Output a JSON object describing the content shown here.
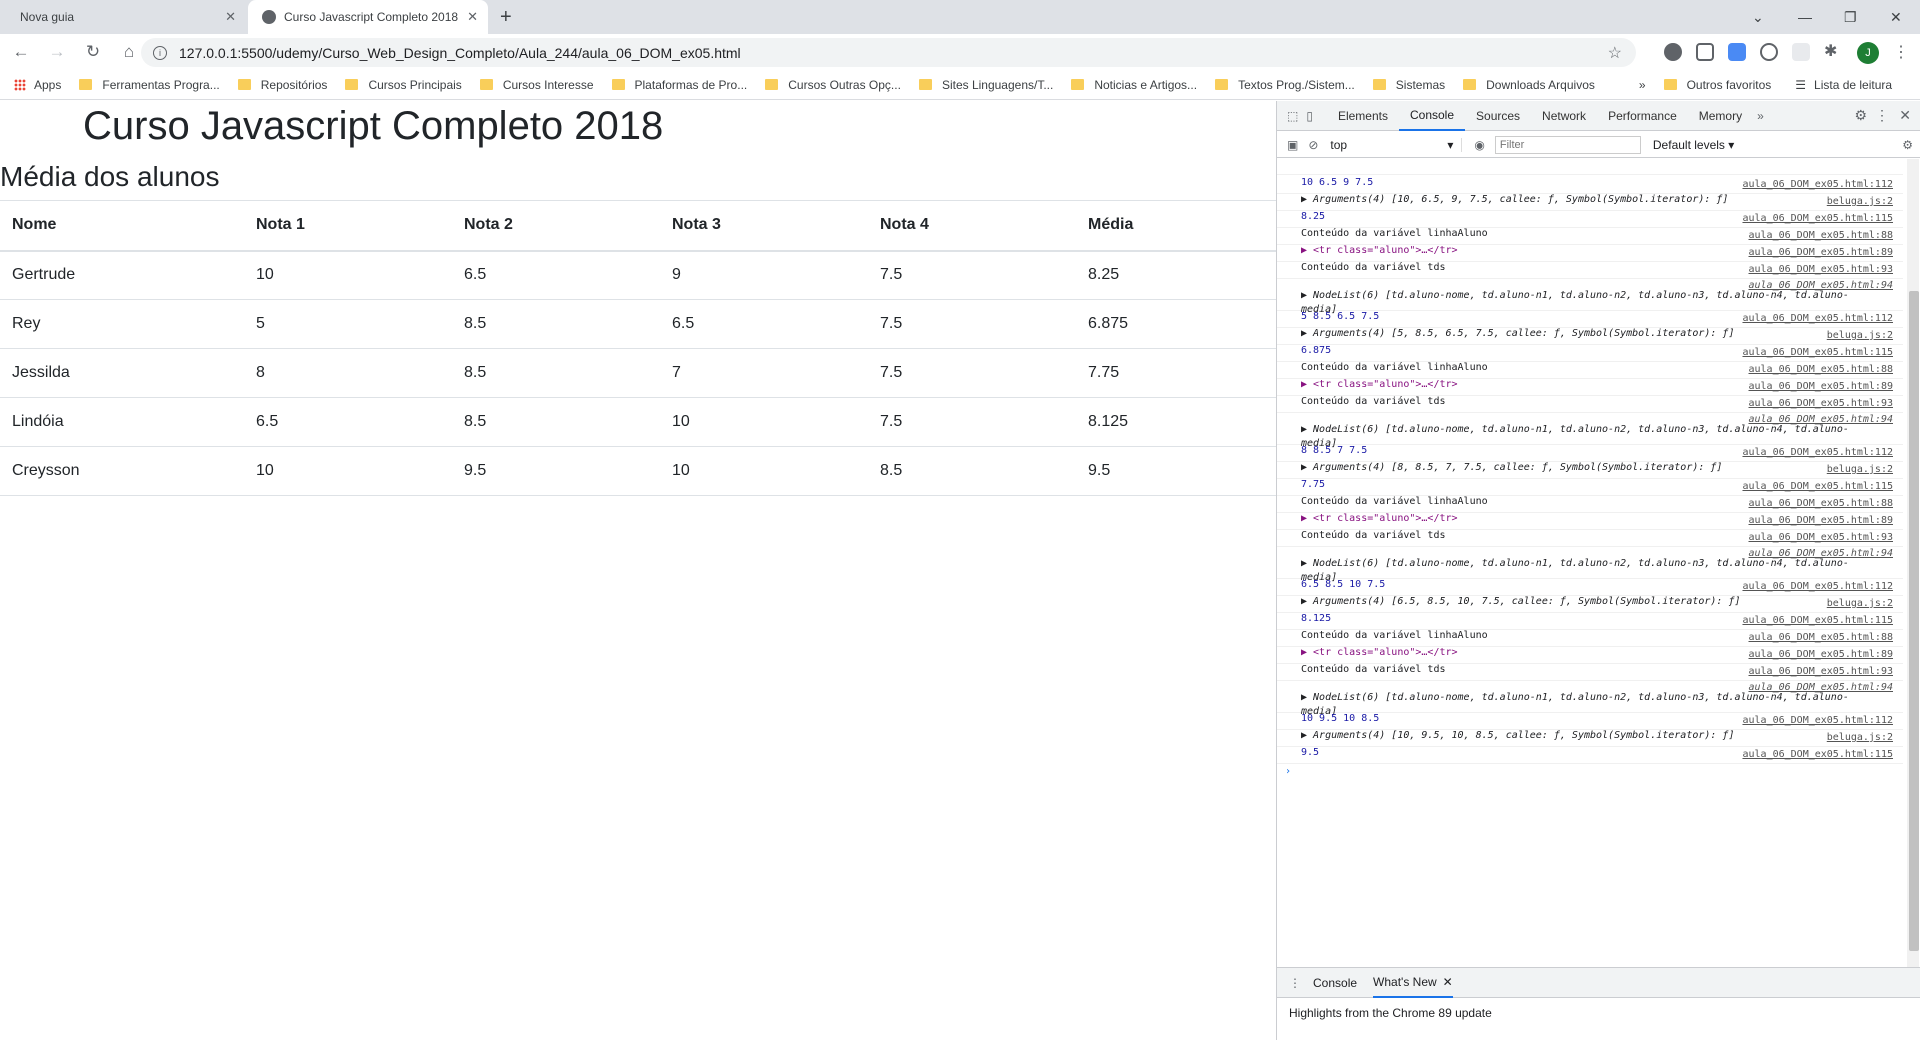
{
  "browser": {
    "tabs": [
      {
        "title": "Nova guia"
      },
      {
        "title": "Curso Javascript Completo 2018"
      }
    ],
    "url": "127.0.0.1:5500/udemy/Curso_Web_Design_Completo/Aula_244/aula_06_DOM_ex05.html",
    "avatar_letter": "J",
    "bookmarks": [
      "Apps",
      "Ferramentas Progra...",
      "Repositórios",
      "Cursos Principais",
      "Cursos Interesse",
      "Plataformas de Pro...",
      "Cursos Outras Opç...",
      "Sites Linguagens/T...",
      "Noticias e Artigos...",
      "Textos Prog./Sistem...",
      "Sistemas",
      "Downloads Arquivos"
    ],
    "other_bookmarks": "Outros favoritos",
    "reading_list": "Lista de leitura"
  },
  "page": {
    "title": "Curso Javascript Completo 2018",
    "subtitle": "Média dos alunos",
    "headers": [
      "Nome",
      "Nota 1",
      "Nota 2",
      "Nota 3",
      "Nota 4",
      "Média"
    ],
    "rows": [
      [
        "Gertrude",
        "10",
        "6.5",
        "9",
        "7.5",
        "8.25"
      ],
      [
        "Rey",
        "5",
        "8.5",
        "6.5",
        "7.5",
        "6.875"
      ],
      [
        "Jessilda",
        "8",
        "8.5",
        "7",
        "7.5",
        "7.75"
      ],
      [
        "Lindóia",
        "6.5",
        "8.5",
        "10",
        "7.5",
        "8.125"
      ],
      [
        "Creysson",
        "10",
        "9.5",
        "10",
        "8.5",
        "9.5"
      ]
    ]
  },
  "devtools": {
    "tabs": [
      "Elements",
      "Console",
      "Sources",
      "Network",
      "Performance",
      "Memory"
    ],
    "context": "top",
    "filter_placeholder": "Filter",
    "levels": "Default levels ▾",
    "drawer_tabs": [
      "Console",
      "What's New"
    ],
    "drawer_text": "Highlights from the Chrome 89 update",
    "lines": [
      {
        "text": "10 6.5 9 7.5",
        "src": "aula_06_DOM_ex05.html:112",
        "kind": "num"
      },
      {
        "text": "▶ Arguments(4) [10, 6.5, 9, 7.5, callee: ƒ, Symbol(Symbol.iterator): ƒ]",
        "src": "beluga.js:2",
        "kind": "arg"
      },
      {
        "text": "8.25",
        "src": "aula_06_DOM_ex05.html:115",
        "kind": "num"
      },
      {
        "text": "Conteúdo da variável linhaAluno",
        "src": "aula_06_DOM_ex05.html:88",
        "kind": "plain"
      },
      {
        "text": "▶ <tr class=\"aluno\">…</tr>",
        "src": "aula_06_DOM_ex05.html:89",
        "kind": "tag"
      },
      {
        "text": "Conteúdo da variável tds",
        "src": "aula_06_DOM_ex05.html:93",
        "kind": "plain"
      },
      {
        "text": "▶ NodeList(6) [td.aluno-nome, td.aluno-n1, td.aluno-n2, td.aluno-n3, td.aluno-n4, td.aluno-media]",
        "src": "aula_06_DOM_ex05.html:94",
        "kind": "obj"
      },
      {
        "text": "5 8.5 6.5 7.5",
        "src": "aula_06_DOM_ex05.html:112",
        "kind": "num"
      },
      {
        "text": "▶ Arguments(4) [5, 8.5, 6.5, 7.5, callee: ƒ, Symbol(Symbol.iterator): ƒ]",
        "src": "beluga.js:2",
        "kind": "arg"
      },
      {
        "text": "6.875",
        "src": "aula_06_DOM_ex05.html:115",
        "kind": "num"
      },
      {
        "text": "Conteúdo da variável linhaAluno",
        "src": "aula_06_DOM_ex05.html:88",
        "kind": "plain"
      },
      {
        "text": "▶ <tr class=\"aluno\">…</tr>",
        "src": "aula_06_DOM_ex05.html:89",
        "kind": "tag"
      },
      {
        "text": "Conteúdo da variável tds",
        "src": "aula_06_DOM_ex05.html:93",
        "kind": "plain"
      },
      {
        "text": "▶ NodeList(6) [td.aluno-nome, td.aluno-n1, td.aluno-n2, td.aluno-n3, td.aluno-n4, td.aluno-media]",
        "src": "aula_06_DOM_ex05.html:94",
        "kind": "obj"
      },
      {
        "text": "8 8.5 7 7.5",
        "src": "aula_06_DOM_ex05.html:112",
        "kind": "num"
      },
      {
        "text": "▶ Arguments(4) [8, 8.5, 7, 7.5, callee: ƒ, Symbol(Symbol.iterator): ƒ]",
        "src": "beluga.js:2",
        "kind": "arg"
      },
      {
        "text": "7.75",
        "src": "aula_06_DOM_ex05.html:115",
        "kind": "num"
      },
      {
        "text": "Conteúdo da variável linhaAluno",
        "src": "aula_06_DOM_ex05.html:88",
        "kind": "plain"
      },
      {
        "text": "▶ <tr class=\"aluno\">…</tr>",
        "src": "aula_06_DOM_ex05.html:89",
        "kind": "tag"
      },
      {
        "text": "Conteúdo da variável tds",
        "src": "aula_06_DOM_ex05.html:93",
        "kind": "plain"
      },
      {
        "text": "▶ NodeList(6) [td.aluno-nome, td.aluno-n1, td.aluno-n2, td.aluno-n3, td.aluno-n4, td.aluno-media]",
        "src": "aula_06_DOM_ex05.html:94",
        "kind": "obj"
      },
      {
        "text": "6.5 8.5 10 7.5",
        "src": "aula_06_DOM_ex05.html:112",
        "kind": "num"
      },
      {
        "text": "▶ Arguments(4) [6.5, 8.5, 10, 7.5, callee: ƒ, Symbol(Symbol.iterator): ƒ]",
        "src": "beluga.js:2",
        "kind": "arg"
      },
      {
        "text": "8.125",
        "src": "aula_06_DOM_ex05.html:115",
        "kind": "num"
      },
      {
        "text": "Conteúdo da variável linhaAluno",
        "src": "aula_06_DOM_ex05.html:88",
        "kind": "plain"
      },
      {
        "text": "▶ <tr class=\"aluno\">…</tr>",
        "src": "aula_06_DOM_ex05.html:89",
        "kind": "tag"
      },
      {
        "text": "Conteúdo da variável tds",
        "src": "aula_06_DOM_ex05.html:93",
        "kind": "plain"
      },
      {
        "text": "▶ NodeList(6) [td.aluno-nome, td.aluno-n1, td.aluno-n2, td.aluno-n3, td.aluno-n4, td.aluno-media]",
        "src": "aula_06_DOM_ex05.html:94",
        "kind": "obj"
      },
      {
        "text": "10 9.5 10 8.5",
        "src": "aula_06_DOM_ex05.html:112",
        "kind": "num"
      },
      {
        "text": "▶ Arguments(4) [10, 9.5, 10, 8.5, callee: ƒ, Symbol(Symbol.iterator): ƒ]",
        "src": "beluga.js:2",
        "kind": "arg"
      },
      {
        "text": "9.5",
        "src": "aula_06_DOM_ex05.html:115",
        "kind": "num"
      }
    ],
    "prompt": "›"
  }
}
